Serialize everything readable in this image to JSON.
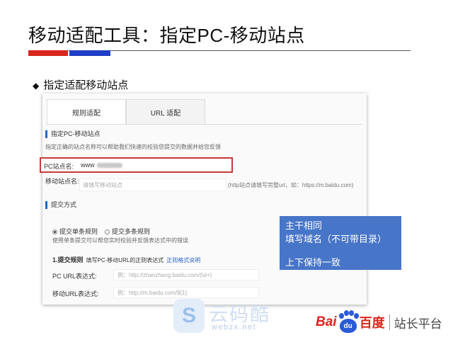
{
  "slide": {
    "title": "移动适配工具：指定PC-移动站点",
    "section_heading": "指定适配移动站点",
    "diamond": "◆"
  },
  "tabs": [
    {
      "label": "规则适配",
      "active": true
    },
    {
      "label": "URL 适配",
      "active": false
    }
  ],
  "form": {
    "section1_title": "指定PC-移动站点",
    "section1_hint": "指定正确的站点名称可以帮助我们快速的校验您提交的数据并给您反馈",
    "pc_label": "PC站点名:",
    "pc_value": "www",
    "mobile_label": "移动站点名:",
    "mobile_placeholder": "请填写移动站点",
    "mobile_note": "(http站点请填写完整url，如：https://m.baidu.com)",
    "section2_title": "提交方式",
    "radio_single": "提交单条规则",
    "radio_multi": "提交多条规则",
    "radio_hint": "使用单条提交可以帮您实时校验并反馈表达式中的错误",
    "step_title": "1.提交规则",
    "step_desc": "填写PC-移动URL的正则表达式",
    "step_link": "正则格式说明",
    "pc_url_label": "PC  URL表达式:",
    "pc_url_placeholder": "例：http://zhanzhang.baidu.com/(\\d+)",
    "mobile_url_label": "移动URL表达式:",
    "mobile_url_placeholder": "例：http://m.baidu.com/${1}"
  },
  "callout": {
    "line1": "主干相同",
    "line2": "填写域名（不可带目录）",
    "line3": "上下保持一致"
  },
  "watermark": {
    "logo_letter": "S",
    "name": "云码酷",
    "url": "webzx.net"
  },
  "brand": {
    "bai": "Bai",
    "paw_text": "du",
    "du": "百度",
    "platform": "站长平台"
  },
  "colors": {
    "accent_red": "#d9261c",
    "accent_blue": "#1f3ec8",
    "callout_blue": "#4775c7",
    "highlight_box": "#c83a3a",
    "link": "#2a64c5"
  }
}
